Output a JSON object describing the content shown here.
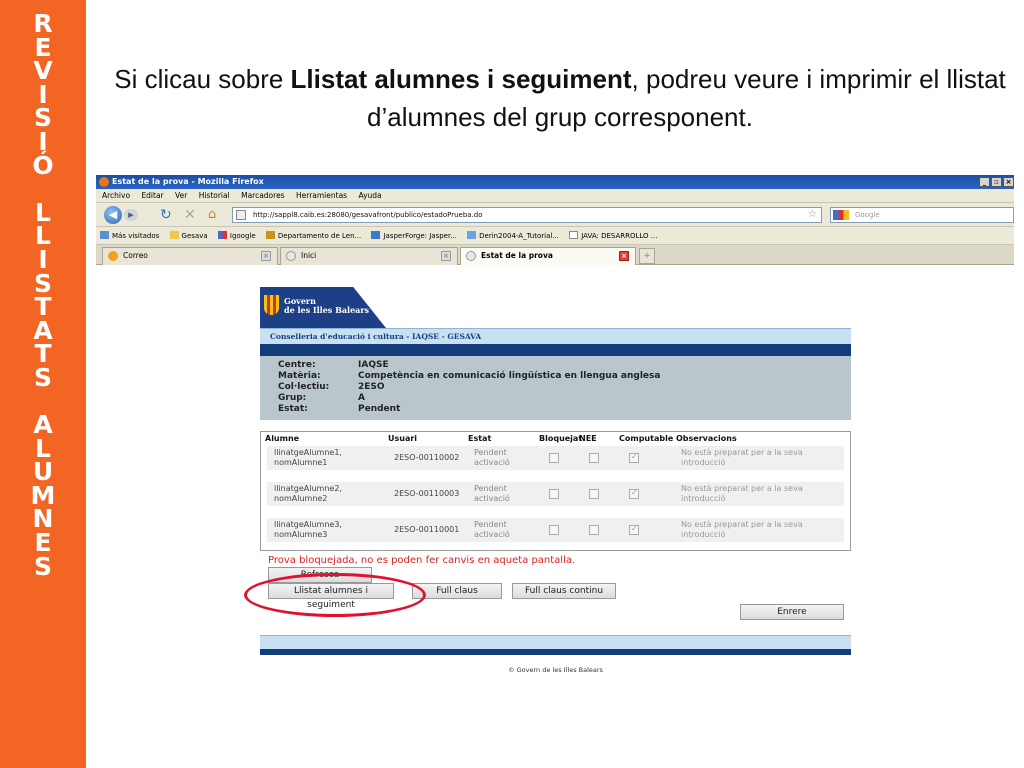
{
  "sidebar": {
    "letters": [
      "R",
      "E",
      "V",
      "I",
      "S",
      "I",
      "Ó",
      " ",
      "L",
      "L",
      "I",
      "S",
      "T",
      "A",
      "T",
      "S",
      " ",
      "A",
      "L",
      "U",
      "M",
      "N",
      "E",
      "S"
    ],
    "color": "#f26522"
  },
  "heading": {
    "pre": "Si clicau sobre ",
    "bold": "Llistat alumnes i seguiment",
    "post": ", podreu veure i imprimir el llistat d’alumnes del grup corresponent."
  },
  "browser": {
    "title": "Estat de la prova - Mozilla Firefox",
    "menu": [
      "Archivo",
      "Editar",
      "Ver",
      "Historial",
      "Marcadores",
      "Herramientas",
      "Ayuda"
    ],
    "url": "http://sappl8.caib.es:28080/gesavafront/publico/estadoPrueba.do",
    "search_placeholder": "Google",
    "bookmarks": [
      "Más visitados",
      "Gesava",
      "Igoogle",
      "Departamento de Len...",
      "JasperForge: Jasper...",
      "Derin2004-A_Tutorial...",
      "JAVA: DESARROLLO ..."
    ],
    "tabs": [
      {
        "label": "Correo",
        "active": false
      },
      {
        "label": "Inici",
        "active": false
      },
      {
        "label": "Estat de la prova",
        "active": true
      }
    ]
  },
  "app": {
    "logo_line1": "Govern",
    "logo_line2": "de les Illes Balears",
    "conselleria": "Conselleria d'educació i cultura - IAQSE - GESAVA",
    "info": [
      {
        "label": "Centre:",
        "value": "IAQSE"
      },
      {
        "label": "Matèria:",
        "value": "Competència en comunicació lingüística en llengua anglesa"
      },
      {
        "label": "Col·lectiu:",
        "value": "2ESO"
      },
      {
        "label": "Grup:",
        "value": "A"
      },
      {
        "label": "Estat:",
        "value": "Pendent"
      }
    ],
    "table": {
      "headers": [
        "Alumne",
        "Usuari",
        "Estat",
        "Bloquejat",
        "NEE",
        "Computable",
        "Observacions"
      ],
      "rows": [
        {
          "alumne1": "llinatgeAlumne1,",
          "alumne2": "nomAlumne1",
          "usuari": "2ESO-00110002",
          "estat1": "Pendent",
          "estat2": "activació",
          "bloquejat": false,
          "nee": false,
          "computable": true,
          "obs1": "No està preparat per a la seva",
          "obs2": "introducció"
        },
        {
          "alumne1": "llinatgeAlumne2,",
          "alumne2": "nomAlumne2",
          "usuari": "2ESO-00110003",
          "estat1": "Pendent",
          "estat2": "activació",
          "bloquejat": false,
          "nee": false,
          "computable": true,
          "obs1": "No està preparat per a la seva",
          "obs2": "introducció"
        },
        {
          "alumne1": "llinatgeAlumne3,",
          "alumne2": "nomAlumne3",
          "usuari": "2ESO-00110001",
          "estat1": "Pendent",
          "estat2": "activació",
          "bloquejat": false,
          "nee": false,
          "computable": true,
          "obs1": "No està preparat per a la seva",
          "obs2": "introducció"
        }
      ]
    },
    "blocked_message": "Prova bloquejada, no es poden fer canvis en aqueta pantalla.",
    "buttons": {
      "refresca": "Refresca",
      "llistat": "Llistat alumnes i seguiment",
      "full_claus": "Full claus",
      "full_claus_continu": "Full claus continu",
      "enrere": "Enrere"
    },
    "copyright": "© Govern de les Illes Balears"
  },
  "colors": {
    "accent_orange": "#f26522",
    "dark_blue": "#123d7a",
    "light_blue": "#c9e0f2",
    "highlight_red": "#e1122e",
    "error_red": "#dd2222"
  }
}
